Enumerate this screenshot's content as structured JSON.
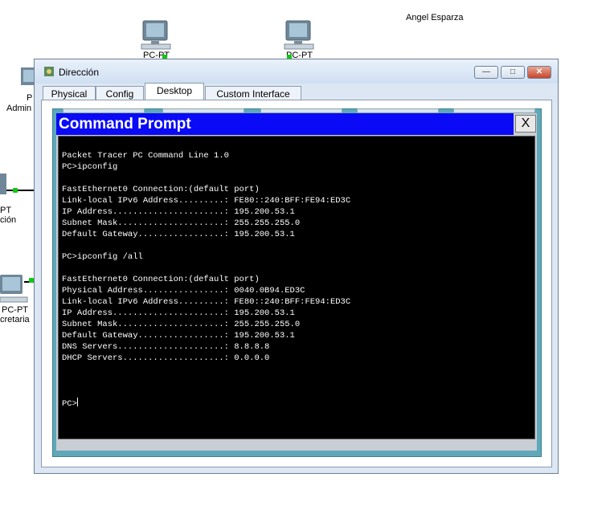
{
  "workspace": {
    "author": "Angel Esparza",
    "devices": [
      {
        "label": "PC-PT"
      },
      {
        "label": "PC-PT"
      },
      {
        "label": "P"
      },
      {
        "label": "Admin"
      },
      {
        "label": "PT"
      },
      {
        "label": "ción"
      },
      {
        "label": "PC-PT"
      },
      {
        "label": "cretaria"
      }
    ]
  },
  "window": {
    "title": "Dirección",
    "minimize": "—",
    "maximize": "□",
    "close": "✕"
  },
  "tabs": [
    {
      "label": "Physical"
    },
    {
      "label": "Config"
    },
    {
      "label": "Desktop"
    },
    {
      "label": "Custom Interface"
    }
  ],
  "cmd": {
    "title": "Command Prompt",
    "close": "X",
    "lines": [
      "Packet Tracer PC Command Line 1.0",
      "PC>ipconfig",
      "",
      "FastEthernet0 Connection:(default port)",
      "Link-local IPv6 Address.........: FE80::240:BFF:FE94:ED3C",
      "IP Address......................: 195.200.53.1",
      "Subnet Mask.....................: 255.255.255.0",
      "Default Gateway.................: 195.200.53.1",
      "",
      "PC>ipconfig /all",
      "",
      "FastEthernet0 Connection:(default port)",
      "Physical Address................: 0040.0B94.ED3C",
      "Link-local IPv6 Address.........: FE80::240:BFF:FE94:ED3C",
      "IP Address......................: 195.200.53.1",
      "Subnet Mask.....................: 255.255.255.0",
      "Default Gateway.................: 195.200.53.1",
      "DNS Servers.....................: 8.8.8.8",
      "DHCP Servers....................: 0.0.0.0",
      "",
      "",
      ""
    ],
    "prompt": "PC>"
  }
}
